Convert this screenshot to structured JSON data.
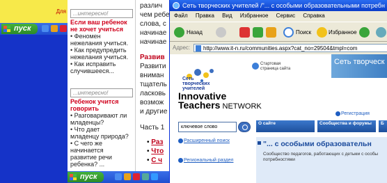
{
  "desktop": {
    "notice_text": "Для",
    "taskbar": {
      "start_label": "пуск"
    }
  },
  "notes": [
    {
      "header": "...интересно!",
      "title": [
        "Если ваш ребенок",
        "не хочет учиться"
      ],
      "lines": [
        "• Феномен",
        "нежелания учиться.",
        "• Как предупредить",
        "нежелания учиться.",
        "• Как исправить",
        "случившееся..."
      ]
    },
    {
      "header": "...интересно!",
      "title": [
        "Ребенок учится",
        "говорить"
      ],
      "lines": [
        "• Разговаривают ли",
        "младенцы?",
        "• Что дает",
        "младенцу природа?",
        "• С чего же",
        "начинается",
        "развитие речи",
        "ребенка? ..."
      ]
    }
  ],
  "article": {
    "lines": [
      "различ",
      "чем ребе",
      "слова, с",
      "начинае",
      "начинае"
    ],
    "heading": "Развив",
    "lines2": [
      "Развити",
      "вниман",
      "тщатель",
      "ласковь",
      "возмож",
      "и другие"
    ],
    "part": "Часть 1",
    "bullets": [
      "Раз",
      "Что",
      "С ч"
    ]
  },
  "ie": {
    "title": "Сеть творческих учителей /\"... с особыми образовательными потребн",
    "menu": [
      "Файл",
      "Правка",
      "Вид",
      "Избранное",
      "Сервис",
      "Справка"
    ],
    "toolbar": {
      "back_label": "Назад",
      "search_label": "Поиск",
      "favorites_label": "Избранное"
    },
    "address": {
      "label": "Адрес:",
      "url": "http://www.it-n.ru/communities.aspx?cat_no=29504&tmpl=com"
    },
    "page": {
      "banner_text": "Сеть творческ",
      "logo_text": [
        "Сеть",
        "творческих",
        "учителей"
      ],
      "home_link": [
        "Стартовая",
        "страница сайта"
      ],
      "itn_line1": "Innovative",
      "itn_line2_bold": "Teachers",
      "itn_line2_rest": " NETWORK",
      "registration": "Регистрация",
      "search_value": "ключевое слово",
      "tabs": [
        "О сайте",
        "Сообщества и форумы",
        "Б"
      ],
      "advanced_search": "Расширенный поиск",
      "regional_section": "Региональный раздел",
      "content_title": "\"... с особыми образовательн",
      "content_desc": "Сообщество педагогов, работающих с детьми с особы потребностями"
    }
  },
  "colors": {
    "desktop_blue": "#1533c8",
    "xp_title_blue": "#0a3cc8",
    "start_green": "#2d8a28",
    "note_red": "#d0001c",
    "notice_yellow": "#f7e94a"
  }
}
